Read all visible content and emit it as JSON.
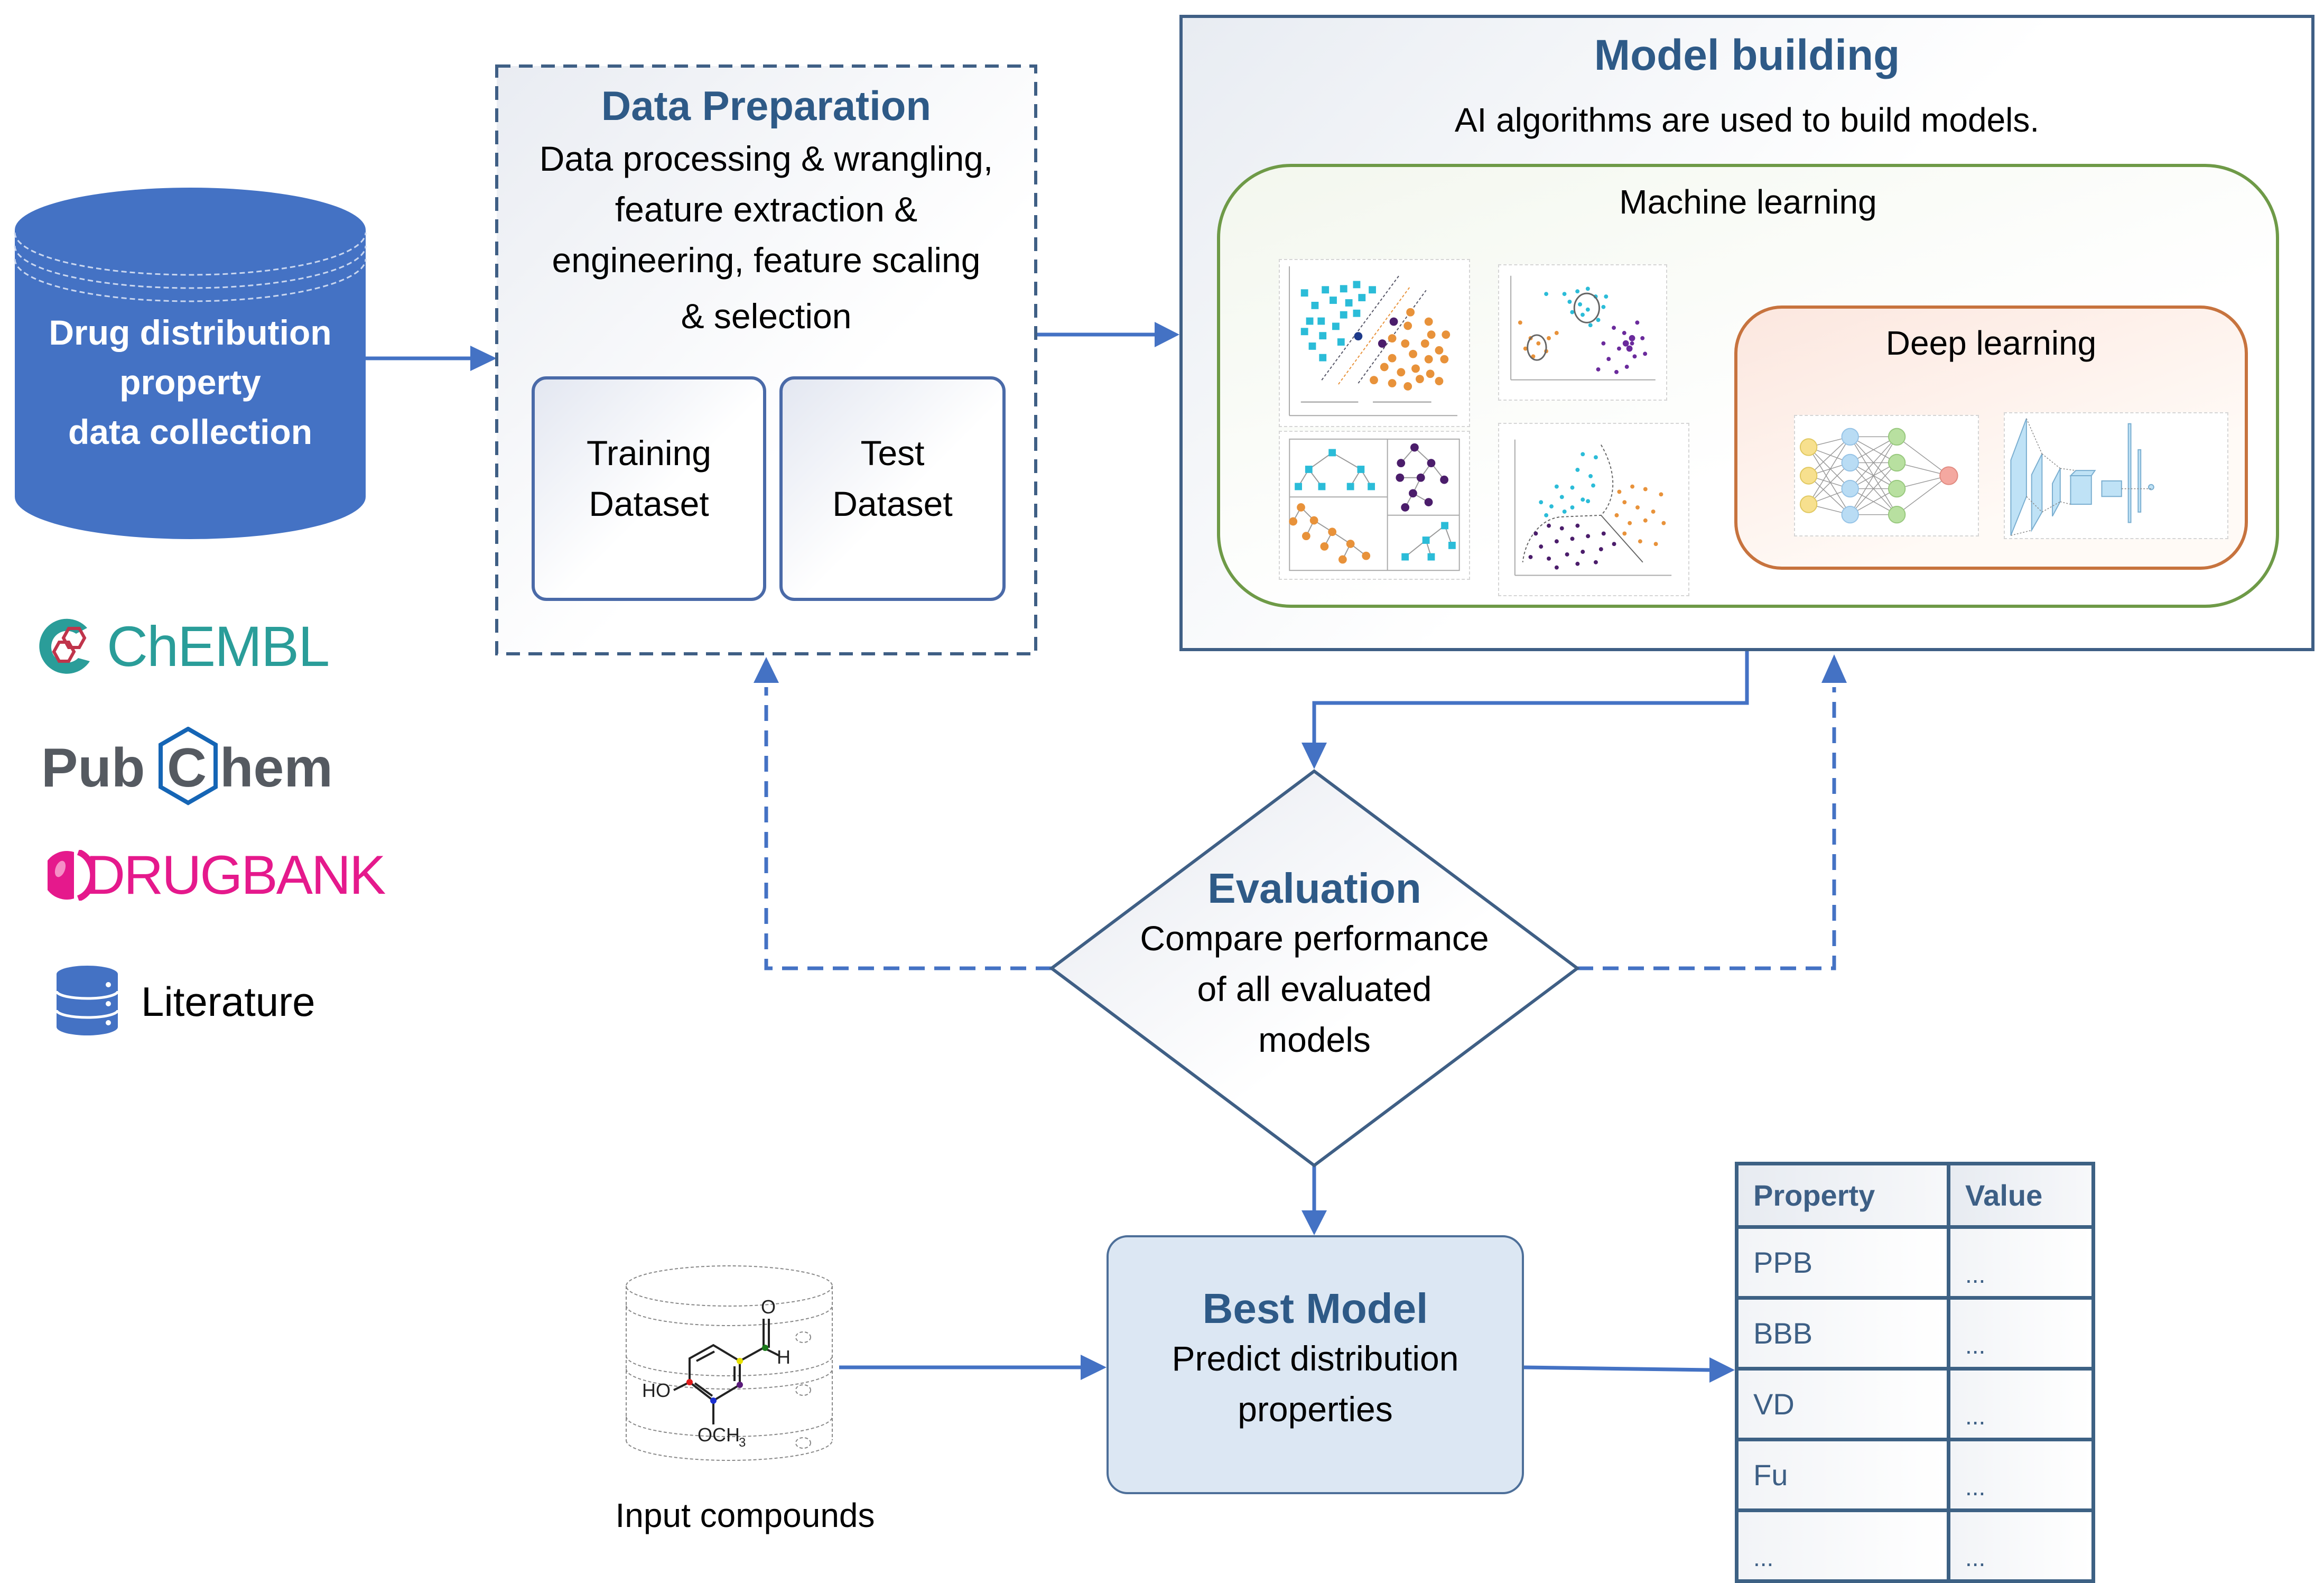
{
  "collection": {
    "cylinder_label_lines": [
      "Drug distribution",
      "property",
      "data collection"
    ],
    "sources": [
      {
        "name": "ChEMBL",
        "icon": "chembl-logo-icon",
        "color": "#2a9d99"
      },
      {
        "name": "PubChem",
        "prefix": "Pub",
        "middle": "C",
        "suffix": "hem",
        "icon": "pubchem-logo-icon",
        "color": "#555a61",
        "accent": "#1565b5"
      },
      {
        "name": "DRUGBANK",
        "text": "DRUGBANK",
        "icon": "drugbank-logo-icon",
        "color": "#e5198c"
      },
      {
        "name": "Literature",
        "icon": "database-icon",
        "color": "#4472c4"
      }
    ]
  },
  "data_preparation": {
    "title": "Data Preparation",
    "description_lines": [
      "Data processing & wrangling,",
      "feature extraction &",
      "engineering, feature scaling",
      "& selection"
    ],
    "datasets": [
      {
        "lines": [
          "Training",
          "Dataset"
        ]
      },
      {
        "lines": [
          "Test",
          "Dataset"
        ]
      }
    ]
  },
  "model_building": {
    "title": "Model building",
    "subtitle": "AI algorithms are used to build models.",
    "machine_learning": {
      "label": "Machine learning",
      "illustrations": [
        "svm-margin-icon",
        "clustering-icon",
        "decision-tree-icon",
        "decision-boundary-icon"
      ]
    },
    "deep_learning": {
      "label": "Deep learning",
      "illustrations": [
        "neural-network-icon",
        "cnn-architecture-icon"
      ]
    }
  },
  "evaluation": {
    "title": "Evaluation",
    "description_lines": [
      "Compare performance",
      "of all evaluated",
      "models"
    ]
  },
  "input": {
    "label": "Input compounds",
    "molecule_labels": {
      "ho": "HO",
      "och3": "OCH",
      "sub3": "3",
      "o": "O",
      "h": "H"
    }
  },
  "best_model": {
    "title": "Best Model",
    "description_lines": [
      "Predict distribution",
      "properties"
    ]
  },
  "output_table": {
    "headers": [
      "Property",
      "Value"
    ],
    "rows": [
      [
        "PPB",
        "..."
      ],
      [
        "BBB",
        "..."
      ],
      [
        "VD",
        "..."
      ],
      [
        "Fu",
        "..."
      ],
      [
        "...",
        "..."
      ]
    ]
  },
  "colors": {
    "arrow": "#4472c4",
    "heading": "#2e5a87",
    "cylinder": "#4472c4"
  }
}
